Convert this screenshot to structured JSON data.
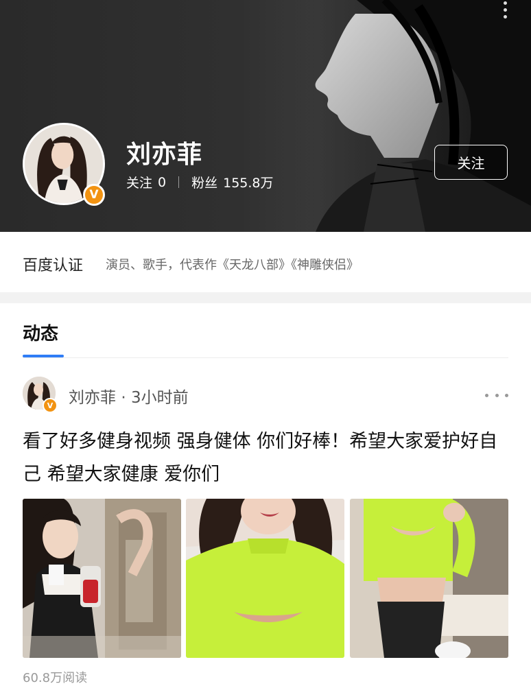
{
  "header": {
    "name": "刘亦菲",
    "following_label": "关注",
    "following_count": "0",
    "fans_label": "粉丝",
    "fans_count": "155.8万",
    "follow_button": "关注",
    "verified_badge": "V",
    "more_icon": "more-vertical-icon"
  },
  "certification": {
    "label": "百度认证",
    "text": "演员、歌手，代表作《天龙八部》《神雕侠侣》"
  },
  "tabs": [
    {
      "label": "动态",
      "active": true
    }
  ],
  "post": {
    "author": "刘亦菲",
    "time": "3小时前",
    "separator": "·",
    "text": "看了好多健身视频 强身健体 你们好棒！希望大家爱护好自己 希望大家健康 爱你们",
    "reads": "60.8万阅读",
    "photo_count": 3,
    "more_icon": "more-horizontal-icon"
  },
  "colors": {
    "accent_blue": "#2f7df6",
    "verified_orange": "#f29312",
    "banner_dark": "#2e2e2e",
    "lime_top": "#c6ef3a"
  }
}
